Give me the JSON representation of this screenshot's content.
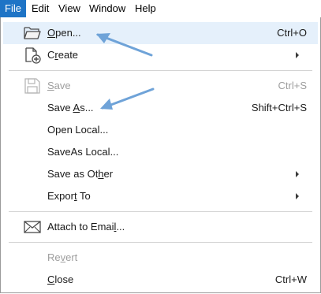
{
  "menubar": {
    "items": [
      {
        "label": "File"
      },
      {
        "label": "Edit"
      },
      {
        "label": "View"
      },
      {
        "label": "Window"
      },
      {
        "label": "Help"
      }
    ]
  },
  "menu": {
    "open": {
      "pre": "",
      "u": "O",
      "post": "pen...",
      "shortcut": "Ctrl+O",
      "icon": "folder-open-icon"
    },
    "create": {
      "pre": "C",
      "u": "r",
      "post": "eate",
      "icon": "create-document-icon"
    },
    "save": {
      "pre": "",
      "u": "S",
      "post": "ave",
      "shortcut": "Ctrl+S",
      "icon": "save-icon"
    },
    "save_as": {
      "pre": "Save ",
      "u": "A",
      "post": "s...",
      "shortcut": "Shift+Ctrl+S"
    },
    "open_local": {
      "label": "Open Local..."
    },
    "saveas_local": {
      "label": "SaveAs Local..."
    },
    "save_as_other": {
      "pre": "Save as Ot",
      "u": "h",
      "post": "er"
    },
    "export_to": {
      "pre": "Expor",
      "u": "t",
      "post": " To"
    },
    "attach_email": {
      "pre": "Attach to Emai",
      "u": "l",
      "post": "...",
      "icon": "envelope-icon"
    },
    "revert": {
      "pre": "Re",
      "u": "v",
      "post": "ert"
    },
    "close": {
      "pre": "",
      "u": "C",
      "post": "lose",
      "shortcut": "Ctrl+W"
    }
  },
  "colors": {
    "menu_active": "#1e74c6",
    "highlight": "#e5f0fb",
    "annotation_arrow": "#6fa3d8"
  }
}
